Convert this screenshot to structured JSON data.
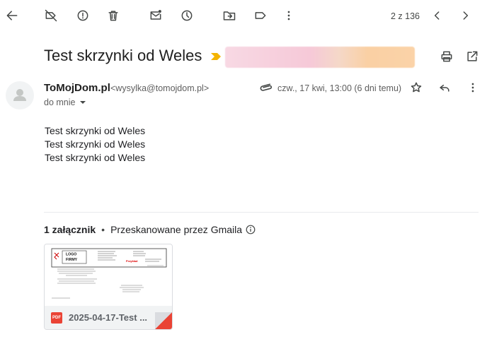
{
  "toolbar": {
    "back": "arrow-back-icon",
    "mark_not_spam": "label-off-icon",
    "report_spam": "report-icon",
    "delete": "trash-icon",
    "mark_unread": "mark-unread-icon",
    "snooze": "clock-icon",
    "move_to": "move-to-folder-icon",
    "labels": "label-icon",
    "more": "more-vert-icon",
    "counter": "2 z 136",
    "prev": "chevron-left-icon",
    "next": "chevron-right-icon"
  },
  "message": {
    "subject": "Test skrzynki od Weles",
    "sender_name": "ToMojDom.pl",
    "sender_email": "<wysylka@tomojdom.pl>",
    "to": "do mnie",
    "date": "czw., 17 kwi, 13:00 (6 dni temu)",
    "body": [
      "Test skrzynki od Weles",
      "Test skrzynki od Weles",
      "Test skrzynki od Weles"
    ]
  },
  "attachments": {
    "count_label": "1 załącznik",
    "scan_label": "Przeskanowane przez Gmaila",
    "items": [
      {
        "name": "2025-04-17-Test ...",
        "type": "PDF",
        "thumb": {
          "logo_text_1": "LOGO",
          "logo_text_2": "FIRMY",
          "stamp": "Przykład"
        }
      }
    ]
  },
  "colors": {
    "text": "#1f1f1f",
    "muted": "#5e5e5e",
    "icon": "#444746",
    "pdf_red": "#ea4335",
    "important_yellow": "#f4b400"
  }
}
